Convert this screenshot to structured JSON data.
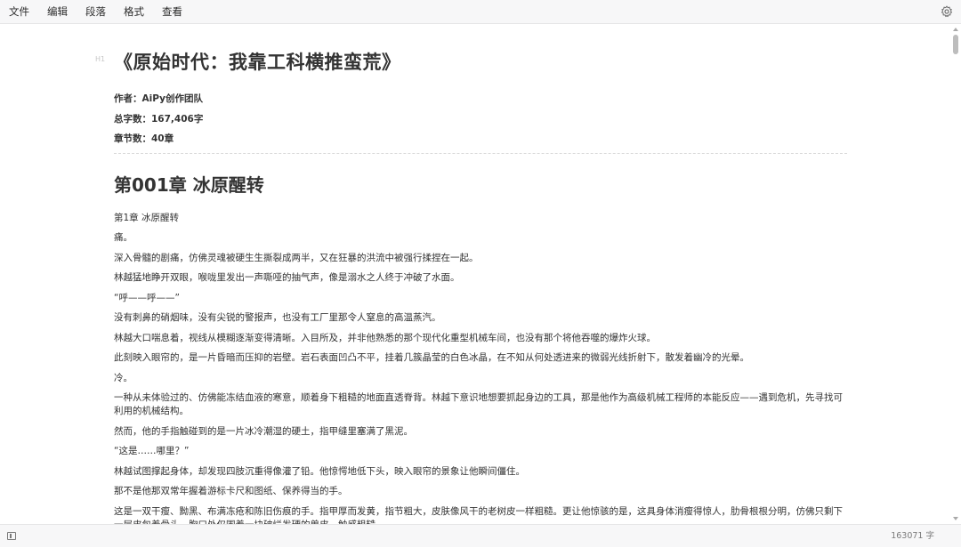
{
  "menubar": {
    "items": [
      "文件",
      "编辑",
      "段落",
      "格式",
      "查看"
    ]
  },
  "icons": {
    "settings": "gear-icon",
    "sidebar": "sidebar-toggle-icon"
  },
  "editor": {
    "heading_hint": "H1",
    "title": "《原始时代：我靠工科横推蛮荒》",
    "meta": [
      "作者：AiPy创作团队",
      "总字数：167,406字",
      "章节数：40章"
    ],
    "chapter_heading": "第001章 冰原醒转",
    "paragraphs": [
      "第1章 冰原醒转",
      "痛。",
      "深入骨髓的剧痛，仿佛灵魂被硬生生撕裂成两半，又在狂暴的洪流中被强行揉捏在一起。",
      "林越猛地睁开双眼，喉咙里发出一声嘶哑的抽气声，像是溺水之人终于冲破了水面。",
      "“呼——呼——”",
      "没有刺鼻的硝烟味，没有尖锐的警报声，也没有工厂里那令人窒息的高温蒸汽。",
      "林越大口喘息着，视线从模糊逐渐变得清晰。入目所及，并非他熟悉的那个现代化重型机械车间，也没有那个将他吞噬的爆炸火球。",
      "此刻映入眼帘的，是一片昏暗而压抑的岩壁。岩石表面凹凸不平，挂着几簇晶莹的白色冰晶，在不知从何处透进来的微弱光线折射下，散发着幽冷的光晕。",
      "冷。",
      "一种从未体验过的、仿佛能冻结血液的寒意，顺着身下粗糙的地面直透脊背。林越下意识地想要抓起身边的工具，那是他作为高级机械工程师的本能反应——遇到危机，先寻找可利用的机械结构。",
      "然而，他的手指触碰到的是一片冰冷潮湿的硬土，指甲缝里塞满了黑泥。",
      "“这是……哪里？”",
      "林越试图撑起身体，却发现四肢沉重得像灌了铅。他惊愕地低下头，映入眼帘的景象让他瞬间僵住。",
      "那不是他那双常年握着游标卡尺和图纸、保养得当的手。",
      "这是一双干瘦、黝黑、布满冻疮和陈旧伤痕的手。指甲厚而发黄，指节粗大，皮肤像风干的老树皮一样粗糙。更让他惊骇的是，这具身体消瘦得惊人，肋骨根根分明，仿佛只剩下一层皮包着骨头。胸口处仅围着一块破烂发硬的兽皮，触感粗糙。"
    ]
  },
  "statusbar": {
    "word_count": "163071 字"
  }
}
